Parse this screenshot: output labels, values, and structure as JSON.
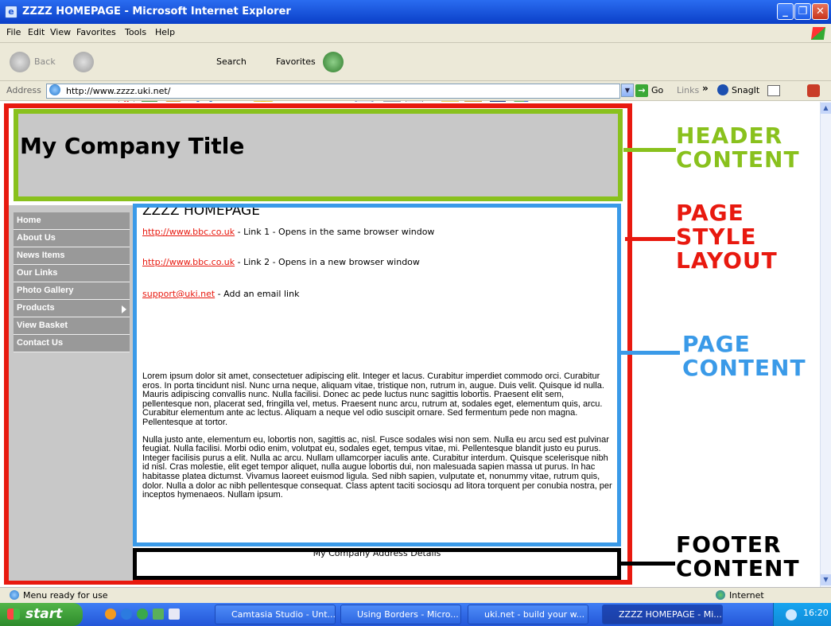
{
  "window": {
    "title": "ZZZZ HOMEPAGE - Microsoft Internet Explorer"
  },
  "menu": [
    "File",
    "Edit",
    "View",
    "Favorites",
    "Tools",
    "Help"
  ],
  "toolbar": {
    "back": "Back",
    "search": "Search",
    "favorites": "Favorites"
  },
  "address": {
    "label": "Address",
    "url": "http://www.zzzz.uki.net/",
    "go": "Go",
    "links": "Links",
    "snagit": "SnagIt"
  },
  "page": {
    "title": "My Company Title",
    "nav": [
      "Home",
      "About Us",
      "News Items",
      "Our Links",
      "Photo Gallery",
      "Products",
      "View Basket",
      "Contact Us"
    ],
    "heading": "ZZZZ HOMEPAGE",
    "links": [
      {
        "url": "http://www.bbc.co.uk",
        "desc": " - Link 1 - Opens in the same browser window"
      },
      {
        "url": "http://www.bbc.co.uk",
        "desc": " - Link 2 - Opens in a new browser window"
      },
      {
        "url": "support@uki.net",
        "desc": " - Add an email link"
      }
    ],
    "paragraphs": [
      "Lorem ipsum dolor sit amet, consectetuer adipiscing elit. Integer et lacus. Curabitur imperdiet commodo orci. Curabitur eros. In porta tincidunt nisl. Nunc urna neque, aliquam vitae, tristique non, rutrum in, augue. Duis velit. Quisque id nulla. Mauris adipiscing convallis nunc. Nulla facilisi. Donec ac pede luctus nunc sagittis lobortis. Praesent elit sem, pellentesque non, placerat sed, fringilla vel, metus. Praesent nunc arcu, rutrum at, sodales eget, elementum quis, arcu. Curabitur elementum ante ac lectus. Aliquam a neque vel odio suscipit ornare. Sed fermentum pede non magna. Pellentesque at tortor.",
      "Nulla justo ante, elementum eu, lobortis non, sagittis ac, nisl. Fusce sodales wisi non sem. Nulla eu arcu sed est pulvinar feugiat. Nulla facilisi. Morbi odio enim, volutpat eu, sodales eget, tempus vitae, mi. Pellentesque blandit justo eu purus. Integer facilisis purus a elit. Nulla ac arcu. Nullam ullamcorper iaculis ante. Curabitur interdum. Quisque scelerisque nibh id nisl. Cras molestie, elit eget tempor aliquet, nulla augue lobortis dui, non malesuada sapien massa ut purus. In hac habitasse platea dictumst. Vivamus laoreet euismod ligula. Sed nibh sapien, vulputate et, nonummy vitae, rutrum quis, dolor. Nulla a dolor ac nibh pellentesque consequat. Class aptent taciti sociosqu ad litora torquent per conubia nostra, per inceptos hymenaeos. Nullam ipsum."
    ],
    "footer": "My Company Address Details"
  },
  "annotations": {
    "header": [
      "HEADER",
      "CONTENT"
    ],
    "layout": [
      "PAGE",
      "STYLE",
      "LAYOUT"
    ],
    "content": [
      "PAGE",
      "CONTENT"
    ],
    "footer": [
      "FOOTER",
      "CONTENT"
    ]
  },
  "colors": {
    "header_ann": "#89c11d",
    "layout_ann": "#e8190f",
    "content_ann": "#3a9ae8",
    "footer_ann": "#000000"
  },
  "status": {
    "text": "Menu ready for use",
    "zone": "Internet"
  },
  "taskbar": {
    "start": "start",
    "tasks": [
      "Camtasia Studio - Unt...",
      "Using Borders - Micro...",
      "uki.net - build your w...",
      "ZZZZ HOMEPAGE - Mi..."
    ],
    "clock": "16:20"
  }
}
